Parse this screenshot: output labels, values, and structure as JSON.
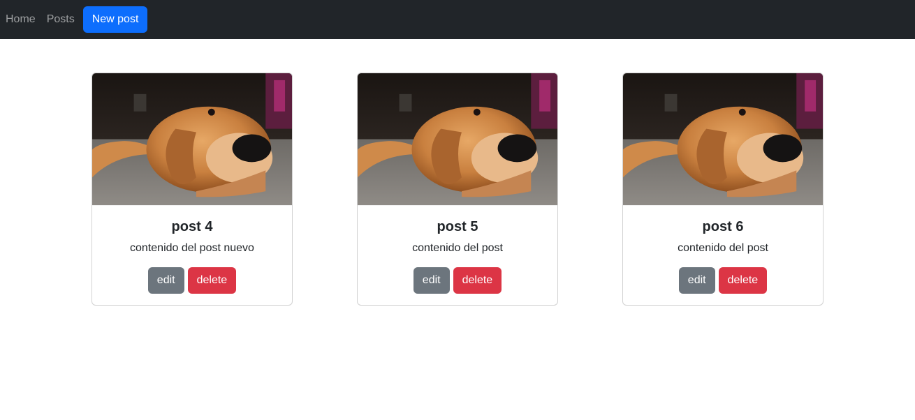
{
  "navbar": {
    "home_label": "Home",
    "posts_label": "Posts",
    "new_post_label": "New post"
  },
  "posts": [
    {
      "title": "post 4",
      "content": "contenido del post nuevo",
      "edit_label": "edit",
      "delete_label": "delete",
      "image": "dog-photo"
    },
    {
      "title": "post 5",
      "content": "contenido del post",
      "edit_label": "edit",
      "delete_label": "delete",
      "image": "dog-photo"
    },
    {
      "title": "post 6",
      "content": "contenido del post",
      "edit_label": "edit",
      "delete_label": "delete",
      "image": "dog-photo"
    }
  ],
  "colors": {
    "navbar_bg": "#212529",
    "primary": "#0d6efd",
    "secondary": "#6c757d",
    "danger": "#dc3545"
  }
}
